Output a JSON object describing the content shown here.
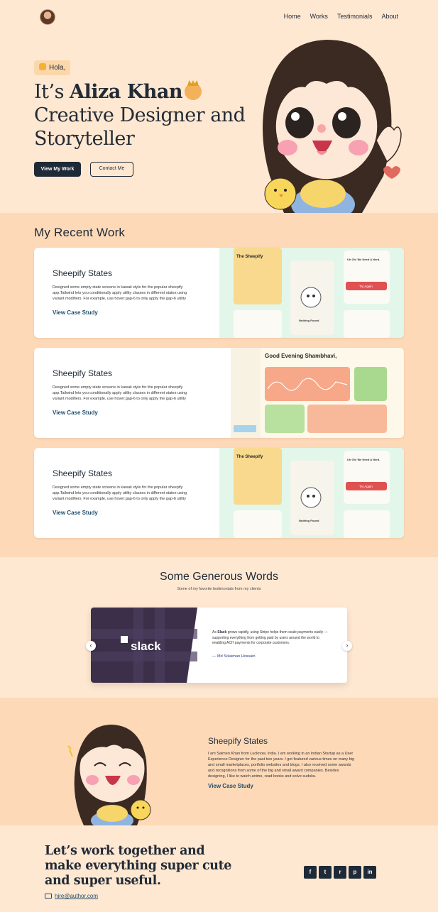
{
  "nav": {
    "links": [
      "Home",
      "Works",
      "Testimonials",
      "About"
    ]
  },
  "hero": {
    "greeting": "Hola,",
    "title_pre": "It’s ",
    "title_name": "Aliza Khan",
    "title_line2": "Creative Designer and",
    "title_line3": "Storyteller",
    "primary_button": "View My Work",
    "secondary_button": "Contact Me"
  },
  "work": {
    "title": "My Recent Work",
    "cards": [
      {
        "title": "Sheepify States",
        "description": "Designed some empty state screens in kawaii style for the popular sheepify app.Tailwind lets you conditionally apply utility classes in different states using variant modifiers. For example, use hover:gap-6 to only apply the gap-6 utility",
        "link": "View Case Study",
        "image_texts": [
          "The Sheepify",
          "Uh Oh! We Need A Nerd.",
          "Try Again",
          "Nothing Found"
        ]
      },
      {
        "title": "Sheepify States",
        "description": "Designed some empty state screens in kawaii style for the popular sheepify app.Tailwind lets you conditionally apply utility classes in different states using variant modifiers. For example, use hover:gap-6 to only apply the gap-6 utility",
        "link": "View Case Study",
        "image_texts": [
          "Good Evening Shambhavi,"
        ]
      },
      {
        "title": "Sheepify States",
        "description": "Designed some empty state screens in kawaii style for the popular sheepify app.Tailwind lets you conditionally apply utility classes in different states using variant modifiers. For example, use hover:gap-6 to only apply the gap-6 utility",
        "link": "View Case Study",
        "image_texts": [
          "The Sheepify",
          "Uh Oh! We Need A Nerd.",
          "Try Again",
          "Nothing Found"
        ]
      }
    ]
  },
  "testimonials": {
    "title": "Some Generous Words",
    "subtitle": "Some of my favorite testimonials from my clients",
    "logo_text": "slack",
    "quote_prefix": "As ",
    "quote_brand": "Slack",
    "quote_rest": " grows rapidly, using Stripe helps them scale payments easily — supporting everything from getting paid by users around the world to enabling ACH payments for corporate customers.",
    "author": "— Md Solaiman Hossain",
    "prev": "‹",
    "next": "›"
  },
  "about": {
    "title": "Sheepify States",
    "description": "I am Saimen Khan from Lucknow, India. I am working in an Indian Startup as a User Experience Designer for the past two years. I got featured various times on many big and small marketplaces, portfolio websites and blogs. I also received some awards and recognitions from some of the big and small award companies. Besides designing, I like to watch anime, read books and solve sudoku.",
    "link": "View Case Study"
  },
  "footer": {
    "title": "Let’s work together and make everything super cute and super useful.",
    "email": "hire@author.com",
    "socials": [
      "facebook-icon",
      "twitter-icon",
      "reddit-icon",
      "pinterest-icon",
      "linkedin-icon"
    ]
  },
  "colors": {
    "background": "#ffe8d2",
    "section_alt": "#fdd9b8",
    "dark": "#1f2a37",
    "link": "#1f4e6e"
  }
}
